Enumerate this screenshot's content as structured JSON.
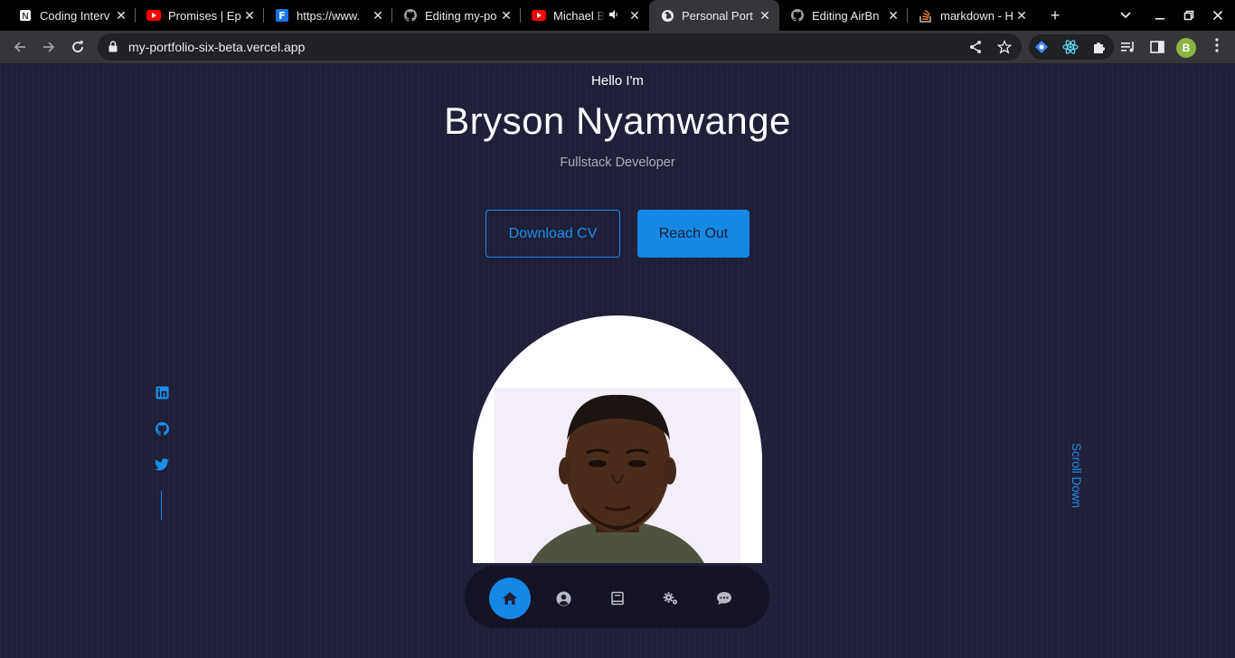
{
  "browser": {
    "tabs": [
      {
        "title": "Coding Interv",
        "icon": "notion-icon",
        "active": false
      },
      {
        "title": "Promises | Ep",
        "icon": "youtube-icon",
        "active": false
      },
      {
        "title": "https://www.",
        "icon": "f-logo-icon",
        "active": false
      },
      {
        "title": "Editing my-po",
        "icon": "github-icon",
        "active": false
      },
      {
        "title": "Michael B",
        "icon": "youtube-icon",
        "active": false,
        "audio": true
      },
      {
        "title": "Personal Port",
        "icon": "globe-icon",
        "active": true
      },
      {
        "title": "Editing AirBn",
        "icon": "github-icon",
        "active": false
      },
      {
        "title": "markdown - H",
        "icon": "stackoverflow-icon",
        "active": false
      }
    ],
    "new_tab_label": "+",
    "url": "my-portfolio-six-beta.vercel.app",
    "profile_initial": "B",
    "close_glyph": "✕"
  },
  "page": {
    "hello": "Hello I'm",
    "name": "Bryson Nyamwange",
    "role": "Fullstack Developer",
    "download_cv": "Download CV",
    "reach_out": "Reach Out",
    "scroll_down": "Scroll Down",
    "socials": [
      "linkedin-icon",
      "github-icon",
      "twitter-icon"
    ],
    "nav": [
      "home-icon",
      "user-icon",
      "book-icon",
      "gears-icon",
      "chat-icon"
    ],
    "active_nav": "home-icon"
  },
  "colors": {
    "background": "#1f1f38",
    "accent": "#1587e4",
    "text_light": "rgba(255,255,255,0.62)"
  }
}
